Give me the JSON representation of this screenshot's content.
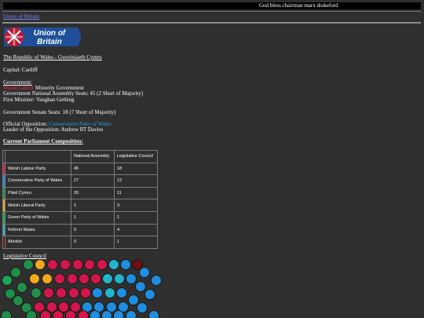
{
  "header": {
    "motto": "God bless chairman marx drakeford"
  },
  "breadcrumb": {
    "label": "Union of Britain"
  },
  "logo": {
    "text_line1": "Union of",
    "text_line2": "Britain"
  },
  "info": {
    "title": "The Republic of Wales - Gweriniaeth Cymru",
    "capital": "Capital: Cardiff",
    "government_heading": "Government:",
    "government_party": "Welsh Labour",
    "government_type": "Minority Government",
    "government_seats": "Government National Assembly Seats: 45 (2 Short of Majority)",
    "first_minister": "First Minister: Vaughan Gething",
    "senate_seats": "Government Senate Seats: 18 (7 Short of Majority)",
    "opposition_label": "Official Opposition:",
    "opposition_party": "Conservative Party of Wales",
    "opposition_leader": "Leader of the Opposition: Andrew RT Davies"
  },
  "composition": {
    "heading": "Current Parliament Composition:",
    "columns": [
      "National Assembly",
      "Legislative Council"
    ],
    "rows": [
      {
        "party": "Welsh Labour Party",
        "color": "#d4174a",
        "na": "45",
        "lc": "18"
      },
      {
        "party": "Conservative Party of Wales",
        "color": "#1f8ee0",
        "na": "27",
        "lc": "12"
      },
      {
        "party": "Plaid Cymru",
        "color": "#1f8f4a",
        "na": "20",
        "lc": "11"
      },
      {
        "party": "Welsh Liberal Party",
        "color": "#f2a81e",
        "na": "1",
        "lc": "3"
      },
      {
        "party": "Green Party of Wales",
        "color": "#1aa654",
        "na": "1",
        "lc": "1"
      },
      {
        "party": "Reform Wales",
        "color": "#25b3c8",
        "na": "0",
        "lc": "4"
      },
      {
        "party": "Abolish",
        "color": "#6b0f12",
        "na": "0",
        "lc": "1"
      }
    ]
  },
  "council": {
    "label": "Legislative Council"
  }
}
